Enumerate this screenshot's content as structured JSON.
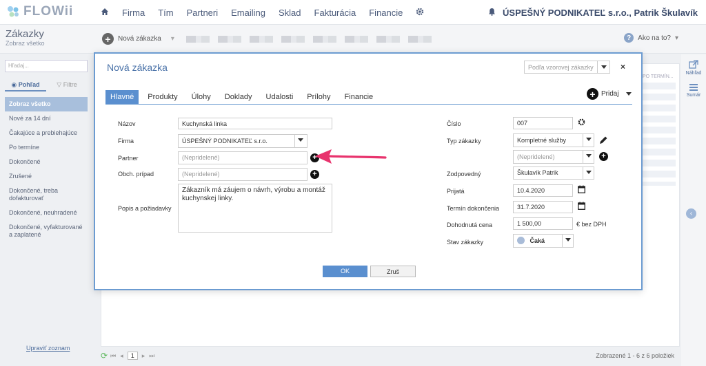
{
  "app": {
    "logo": "FLOWii"
  },
  "nav": {
    "items": [
      "Firma",
      "Tím",
      "Partneri",
      "Emailing",
      "Sklad",
      "Fakturácia",
      "Financie"
    ],
    "company": "ÚSPEŠNÝ PODNIKATEĽ s.r.o., Patrik Škulavík"
  },
  "subbar": {
    "title": "Zákazky",
    "subtitle": "Zobraz všetko",
    "new_label": "Nová zákazka",
    "help_label": "Ako na to?"
  },
  "sidebar": {
    "search_placeholder": "Hľadaj...",
    "tab_view": "Pohľad",
    "tab_filter": "Filtre",
    "items": [
      "Zobraz všetko",
      "Nové za 14 dní",
      "Čakajúce a prebiehajúce",
      "Po termíne",
      "Dokončené",
      "Zrušené",
      "Dokončené, treba dofakturovať",
      "Dokončené, neuhradené",
      "Dokončené, vyfakturované a zaplatené"
    ],
    "footer": "Upraviť zoznam"
  },
  "right_panel": {
    "preview": "Náhľad",
    "summary": "Sumár"
  },
  "background": {
    "column_label": "PO TERMÍN..."
  },
  "bottom": {
    "page": "1",
    "count": "Zobrazené 1 - 6 z 6 položiek"
  },
  "modal": {
    "title": "Nová zákazka",
    "template_placeholder": "Podľa vzorovej zákazky",
    "close": "×",
    "tabs": [
      "Hlavné",
      "Produkty",
      "Úlohy",
      "Doklady",
      "Udalosti",
      "Prílohy",
      "Financie"
    ],
    "add_label": "Pridaj",
    "left": {
      "name_label": "Názov",
      "name_value": "Kuchynská linka",
      "company_label": "Firma",
      "company_value": "ÚSPEŠNÝ PODNIKATEĽ s.r.o.",
      "partner_label": "Partner",
      "partner_placeholder": "(Nepridelené)",
      "case_label": "Obch. prípad",
      "case_placeholder": "(Nepridelené)",
      "desc_label": "Popis a požiadavky",
      "desc_value": "Zákazník má záujem o návrh, výrobu a montáž kuchynskej linky."
    },
    "right": {
      "number_label": "Číslo",
      "number_value": "007",
      "type_label": "Typ zákazky",
      "type_value": "Kompletné služby",
      "type2_placeholder": "(Nepridelené)",
      "resp_label": "Zodpovedný",
      "resp_value": "Škulavík Patrik",
      "accepted_label": "Prijatá",
      "accepted_value": "10.4.2020",
      "due_label": "Termín dokončenia",
      "due_value": "31.7.2020",
      "price_label": "Dohodnutá cena",
      "price_value": "1 500,00",
      "price_unit": "€ bez DPH",
      "status_label": "Stav zákazky",
      "status_value": "Čaká"
    },
    "ok": "OK",
    "cancel": "Zruš"
  },
  "colors": {
    "accent": "#5a8fcf",
    "arrow": "#e8336d",
    "border": "#6b9bd1"
  }
}
